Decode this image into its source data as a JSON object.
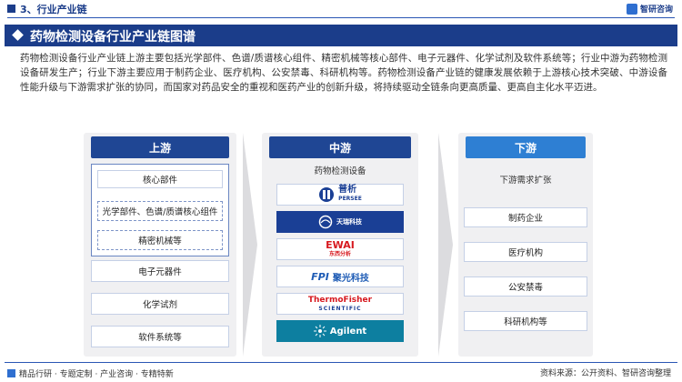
{
  "header": {
    "section_label": "3、行业产业链",
    "logo_text": "智研咨询",
    "logo_icon": "zhiyan-logo-icon"
  },
  "title": "药物检测设备行业产业链图谱",
  "description": "药物检测设备行业产业链上游主要包括光学部件、色谱/质谱核心组件、精密机械等核心部件、电子元器件、化学试剂及软件系统等；行业中游为药物检测设备研发生产；行业下游主要应用于制药企业、医疗机构、公安禁毒、科研机构等。药物检测设备产业链的健康发展依赖于上游核心技术突破、中游设备性能升级与下游需求扩张的协同，而国家对药品安全的重视和医药产业的创新升级，将持续驱动全链条向更高质量、更高自主化水平迈进。",
  "upstream": {
    "label": "上游",
    "core_group": {
      "title": "核心部件",
      "items": [
        "光学部件、色谱/质谱核心组件",
        "精密机械等"
      ]
    },
    "items": [
      "电子元器件",
      "化学试剂",
      "软件系统等"
    ]
  },
  "midstream": {
    "label": "中游",
    "subtitle": "药物检测设备",
    "brands": [
      {
        "name": "普析",
        "sub": "PERSEE",
        "icon": "persee-logo-icon"
      },
      {
        "name": "天瑞科技",
        "sub": "",
        "icon": "tianrui-logo-icon"
      },
      {
        "name": "EWAI",
        "sub": "东西分析",
        "icon": "ewai-logo-icon"
      },
      {
        "name": "聚光科技",
        "sub": "FPI",
        "icon": "fpi-logo-icon"
      },
      {
        "name": "ThermoFisher",
        "sub": "SCIENTIFIC",
        "icon": "thermofisher-logo-icon"
      },
      {
        "name": "Agilent",
        "sub": "",
        "icon": "agilent-logo-icon"
      }
    ]
  },
  "downstream": {
    "label": "下游",
    "subtitle": "下游需求扩张",
    "items": [
      "制药企业",
      "医疗机构",
      "公安禁毒",
      "科研机构等"
    ]
  },
  "footer": {
    "left_text": "精品行研 · 专题定制 · 产业咨询 · 专精特新",
    "source_text": "资料来源：公开资料、智研咨询整理"
  },
  "colors": {
    "primary": "#1b3d8a",
    "downstream_head": "#2e7fd3",
    "ewai_red": "#d7191f",
    "fpi_blue": "#1d5bb5"
  }
}
